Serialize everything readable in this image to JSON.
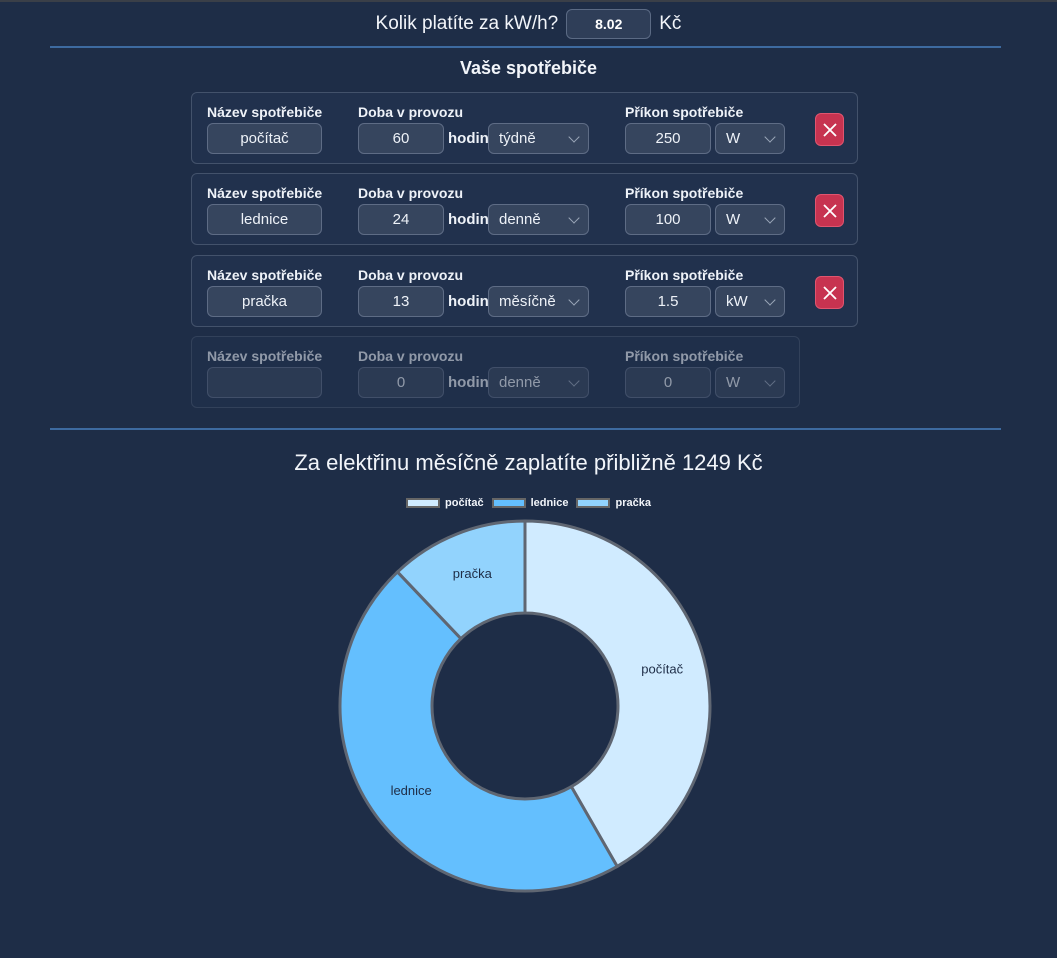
{
  "price": {
    "label": "Kolik platíte za kW/h?",
    "value": "8.02",
    "currency": "Kč"
  },
  "section_title": "Vaše spotřebiče",
  "labels": {
    "name": "Název spotřebiče",
    "duration": "Doba v provozu",
    "power": "Příkon spotřebiče",
    "hours": "hodin"
  },
  "appliances": [
    {
      "name": "počítač",
      "hours": "60",
      "period": "týdně",
      "power": "250",
      "unit": "W"
    },
    {
      "name": "lednice",
      "hours": "24",
      "period": "denně",
      "power": "100",
      "unit": "W"
    },
    {
      "name": "pračka",
      "hours": "13",
      "period": "měsíčně",
      "power": "1.5",
      "unit": "kW"
    }
  ],
  "new_appliance": {
    "name": "",
    "hours": "0",
    "period": "denně",
    "power": "0",
    "unit": "W"
  },
  "result_title": "Za elektřinu měsíčně zaplatíte přibližně 1249 Kč",
  "colors": {
    "accent_line": "#3d6aa0",
    "delete_button": "#c73350",
    "background": "#1e2d47"
  },
  "chart_data": {
    "type": "pie",
    "categories": [
      "počítač",
      "lednice",
      "pračka"
    ],
    "values": [
      41.7,
      46.2,
      12.1
    ],
    "colors": [
      "#d0ebff",
      "#64bffe",
      "#92d3fd"
    ],
    "legend": "top"
  }
}
